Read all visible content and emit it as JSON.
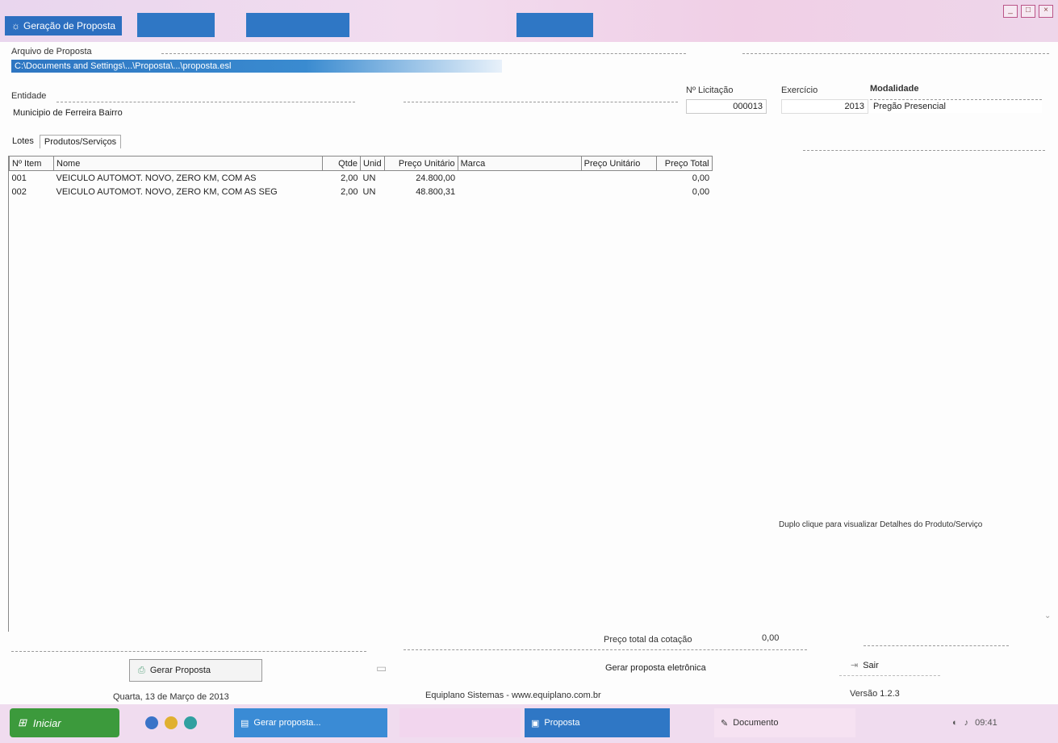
{
  "window": {
    "title": "Geração de Proposta",
    "controls": [
      "_",
      "□",
      "×"
    ]
  },
  "form": {
    "file_label": "Arquivo de Proposta",
    "file_path": "C:\\Documents and Settings\\...\\Proposta\\...\\proposta.esl",
    "entity_label": "Entidade",
    "entity_value": "Municipio de Ferreira Bairro",
    "licitacao_label": "Nº Licitação",
    "licitacao_value": "000013",
    "exercicio_label": "Exercício",
    "exercicio_value": "2013",
    "modalidade_label": "Modalidade",
    "modalidade_value": "Pregão Presencial"
  },
  "tabs": [
    {
      "label": "Lotes"
    },
    {
      "label": "Produtos/Serviços"
    }
  ],
  "table": {
    "headers": [
      "Nº Item",
      "Nome",
      "Qtde",
      "Unid",
      "Preço Unitário",
      "Marca",
      "Preço Unitário",
      "Preço Total"
    ],
    "rows": [
      {
        "item": "001",
        "nome": "VEICULO AUTOMOT. NOVO, ZERO KM, COM AS",
        "qtde": "2,00",
        "unid": "UN",
        "preco_ref": "24.800,00",
        "marca": "",
        "preco_unit": "",
        "total": "0,00"
      },
      {
        "item": "002",
        "nome": "VEICULO AUTOMOT. NOVO, ZERO KM, COM AS SEG",
        "qtde": "2,00",
        "unid": "UN",
        "preco_ref": "48.800,31",
        "marca": "",
        "preco_unit": "",
        "total": "0,00"
      }
    ]
  },
  "hint_text": "Duplo clique para visualizar Detalhes do Produto/Serviço",
  "footer": {
    "total_label": "Preço total da cotação",
    "total_value": "0,00",
    "print_button": "Gerar Proposta",
    "save_button": "Sair",
    "center_text": "Gerar proposta eletrônica",
    "date_text": "Quarta, 13 de Março de 2013",
    "company_text": "Equiplano Sistemas - www.equiplano.com.br",
    "version_text": "Versão 1.2.3"
  },
  "taskbar": {
    "start_label": "Iniciar",
    "tasks": [
      "Gerar proposta...",
      "",
      "Proposta",
      "Documento"
    ],
    "tray_time": "09:41"
  },
  "colors": {
    "accent": "#2f77c5",
    "titlebar": "#efd8ec",
    "start": "#3c9a3c"
  }
}
